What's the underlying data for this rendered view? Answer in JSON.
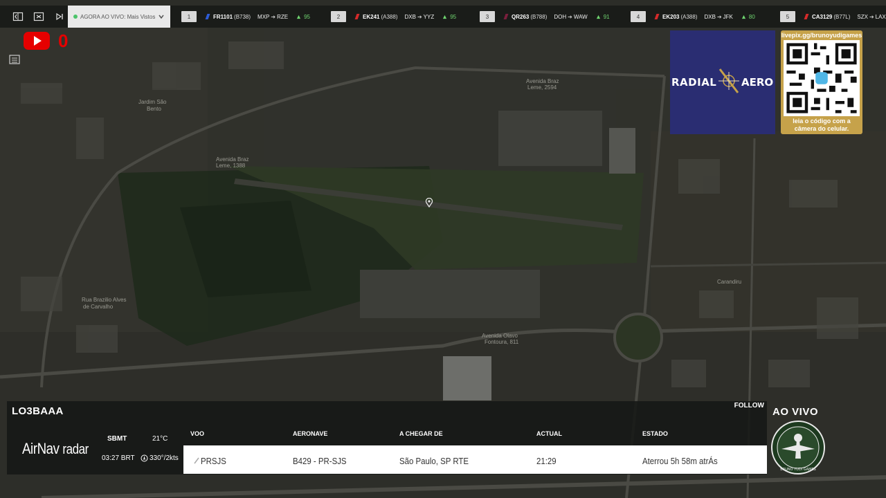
{
  "topbar": {
    "mode_label": "AGORA AO VIVO: Mais Vistos",
    "flights": [
      {
        "num": "1",
        "code": "FR1101",
        "type": "(B738)",
        "from": "MXP",
        "to": "RZE",
        "pct": "95",
        "tail_color": "#2d5bd6"
      },
      {
        "num": "2",
        "code": "EK241",
        "type": "(A388)",
        "from": "DXB",
        "to": "YYZ",
        "pct": "95",
        "tail_color": "#d42a2a"
      },
      {
        "num": "3",
        "code": "QR263",
        "type": "(B788)",
        "from": "DOH",
        "to": "WAW",
        "pct": "91",
        "tail_color": "#7a1f3d"
      },
      {
        "num": "4",
        "code": "EK203",
        "type": "(A388)",
        "from": "DXB",
        "to": "JFK",
        "pct": "80",
        "tail_color": "#d42a2a"
      },
      {
        "num": "5",
        "code": "CA3129",
        "type": "(B77L)",
        "from": "SZX",
        "to": "LAX",
        "pct": "",
        "tail_color": "#d42a2a"
      }
    ]
  },
  "youtube": {
    "count": "0"
  },
  "ads": {
    "radial_left": "RADIAL",
    "radial_right": "AERO",
    "qr_url": "livepix.gg/brunoyudigames",
    "qr_caption_1": "leia o código com a",
    "qr_caption_2": "câmera do celular."
  },
  "panel": {
    "callsign": "LO3BAAA",
    "follow": "FOLLOW",
    "brand_bold": "AirNav",
    "brand_thin": "radar",
    "airport": "SBMT",
    "temp": "21°C",
    "local_time": "03:27 BRT",
    "wind": "330°/2kts",
    "headers": {
      "voo": "VOO",
      "aeronave": "AERONAVE",
      "origem": "A CHEGAR DE",
      "actual": "ACTUAL",
      "estado": "ESTADO"
    },
    "row": {
      "voo": "PRSJS",
      "aeronave": "B429 - PR-SJS",
      "origem": "São Paulo, SP RTE",
      "actual": "21:29",
      "estado": "Aterrou 5h 58m atrÁs"
    }
  },
  "overlay": {
    "ao_vivo": "AO VIVO",
    "badge_text": "BRUNO YUDI GAMES"
  },
  "colors": {
    "accent": "#e60000",
    "brand_blue": "#2a2d72",
    "gold": "#c6a24a",
    "green_pct": "#6fd46f"
  }
}
